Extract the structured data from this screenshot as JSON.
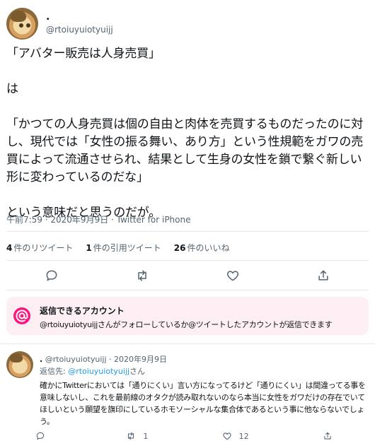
{
  "tweet": {
    "display_name": ".",
    "handle": "@rtoiuyuiotyuijj",
    "body": "「アバター販売は人身売買」\n\nは\n\n「かつての人身売買は個の自由と肉体を売買するものだったのに対し、現代では「女性の振る舞い、あり方」という性規範をガワの売買によって流通させられ、結果として生身の女性を鎖で繋ぐ新しい形に変わっているのだな」\n\nという意味だと思うのだが。",
    "meta": "午前7:59 · 2020年9月9日 · Twitter for iPhone"
  },
  "stats": {
    "retweets_count": "4",
    "retweets_label": "件のリツイート",
    "quotes_count": "1",
    "quotes_label": "件の引用ツイート",
    "likes_count": "26",
    "likes_label": "件のいいね"
  },
  "actions": {
    "icons": [
      "reply-icon",
      "retweet-icon",
      "like-icon",
      "share-icon"
    ]
  },
  "reply_restriction": {
    "title": "返信できるアカウント",
    "description": "@rtoiuyuiotyuijjさんがフォローしているか@ツイートしたアカウントが返信できます",
    "accent": "#f91880"
  },
  "reply": {
    "display_name": ".",
    "handle_date": "@rtoiuyuiotyuijj · 2020年9月9日",
    "to_prefix": "返信先: ",
    "to_mention": "@rtoiuyuiotyuijj",
    "to_suffix": "さん",
    "body": "確かにTwitterにおいては「通りにくい」言い方になってるけど「通りにくい」は間違ってる事を意味しないし、これを最前線のオタクが読み取れないのなら本当に女性をガワだけの存在でいてほしいという願望を旗印にしているホモソーシャルな集合体であるという事に他ならないでしょう。",
    "reply_count": "",
    "retweet_count": "1",
    "like_count": "12"
  }
}
